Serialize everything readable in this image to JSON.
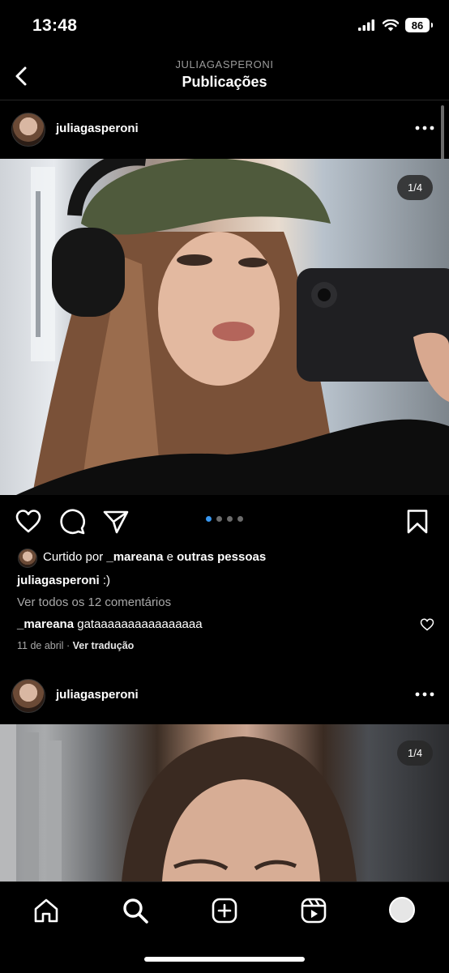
{
  "status_bar": {
    "time": "13:48",
    "battery": "86"
  },
  "header": {
    "subtitle": "JULIAGASPERONI",
    "title": "Publicações"
  },
  "posts": [
    {
      "username": "juliagasperoni",
      "counter": "1/4",
      "liked_prefix": "Curtido por",
      "liked_user": "_mareana",
      "liked_conj": "e",
      "liked_others": "outras pessoas",
      "caption_user": "juliagasperoni",
      "caption_text": ":)",
      "view_comments": "Ver todos os 12 comentários",
      "comment_user": "_mareana",
      "comment_text": "gataaaaaaaaaaaaaaaa",
      "date": "11 de abril",
      "separator": "·",
      "translate": "Ver tradução",
      "pager": {
        "count": 4,
        "active": 1
      }
    },
    {
      "username": "juliagasperoni",
      "counter": "1/4"
    }
  ],
  "bottom_nav": [
    "home-icon",
    "search-icon",
    "create-icon",
    "reels-icon",
    "profile-icon"
  ],
  "colors": {
    "background": "#000000",
    "accent": "#3897f0",
    "secondary_text": "#a8a8a8"
  }
}
